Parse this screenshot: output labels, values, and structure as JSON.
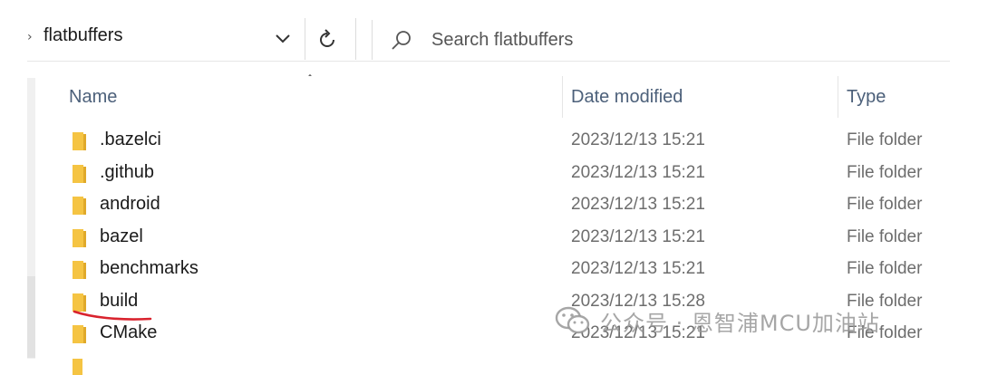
{
  "address_bar": {
    "path_segment": "flatbuffers",
    "crumb_arrow": "›"
  },
  "search": {
    "placeholder": "Search flatbuffers"
  },
  "columns": {
    "name": "Name",
    "date_modified": "Date modified",
    "type": "Type"
  },
  "files": [
    {
      "name": ".bazelci",
      "date": "2023/12/13 15:21",
      "type": "File folder"
    },
    {
      "name": ".github",
      "date": "2023/12/13 15:21",
      "type": "File folder"
    },
    {
      "name": "android",
      "date": "2023/12/13 15:21",
      "type": "File folder"
    },
    {
      "name": "bazel",
      "date": "2023/12/13 15:21",
      "type": "File folder"
    },
    {
      "name": "benchmarks",
      "date": "2023/12/13 15:21",
      "type": "File folder"
    },
    {
      "name": "build",
      "date": "2023/12/13 15:28",
      "type": "File folder"
    },
    {
      "name": "CMake",
      "date": "2023/12/13 15:21",
      "type": "File folder"
    }
  ],
  "watermark": {
    "text": "公众号 · 恩智浦MCU加油站"
  },
  "colors": {
    "folder": "#f5c443",
    "folder_dark": "#e0a92a",
    "header_text": "#4c607a",
    "annotation_red": "#d9232e"
  },
  "icons": {
    "dropdown": "chevron-down-icon",
    "refresh": "refresh-icon",
    "search": "search-icon",
    "folder": "folder-icon",
    "sort": "sort-ascending-icon"
  }
}
